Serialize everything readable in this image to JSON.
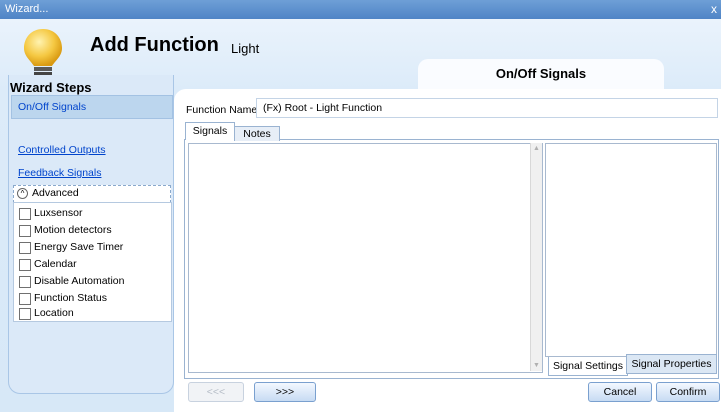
{
  "window": {
    "title": "Wizard...",
    "close": "x"
  },
  "header": {
    "title": "Add Function",
    "subtitle": "Light",
    "step_tab": "On/Off Signals"
  },
  "sidebar": {
    "title": "Wizard Steps",
    "links": [
      "On/Off Signals",
      "Controlled Outputs",
      "Feedback Signals"
    ],
    "advanced_label": "Advanced",
    "advanced_icon": "^",
    "advanced_items": [
      "Luxsensor",
      "Motion detectors",
      "Energy Save Timer",
      "Calendar",
      "Disable Automation",
      "Function Status",
      "Location"
    ]
  },
  "function": {
    "label": "Function Name:",
    "value": "(Fx) Root - Light Function"
  },
  "tabs": {
    "signals": "Signals",
    "notes": "Notes"
  },
  "props_tabs": {
    "settings": "Signal Settings",
    "properties": "Signal Properties"
  },
  "scroll": {
    "up": "▲",
    "down": "▼"
  },
  "buttons": {
    "back": "<<<",
    "next": ">>>",
    "cancel": "Cancel",
    "confirm": "Confirm"
  },
  "colors": {
    "titlebar": "#5a8fd0",
    "link": "#0044cc",
    "accent_bulb": "#f5c842"
  }
}
